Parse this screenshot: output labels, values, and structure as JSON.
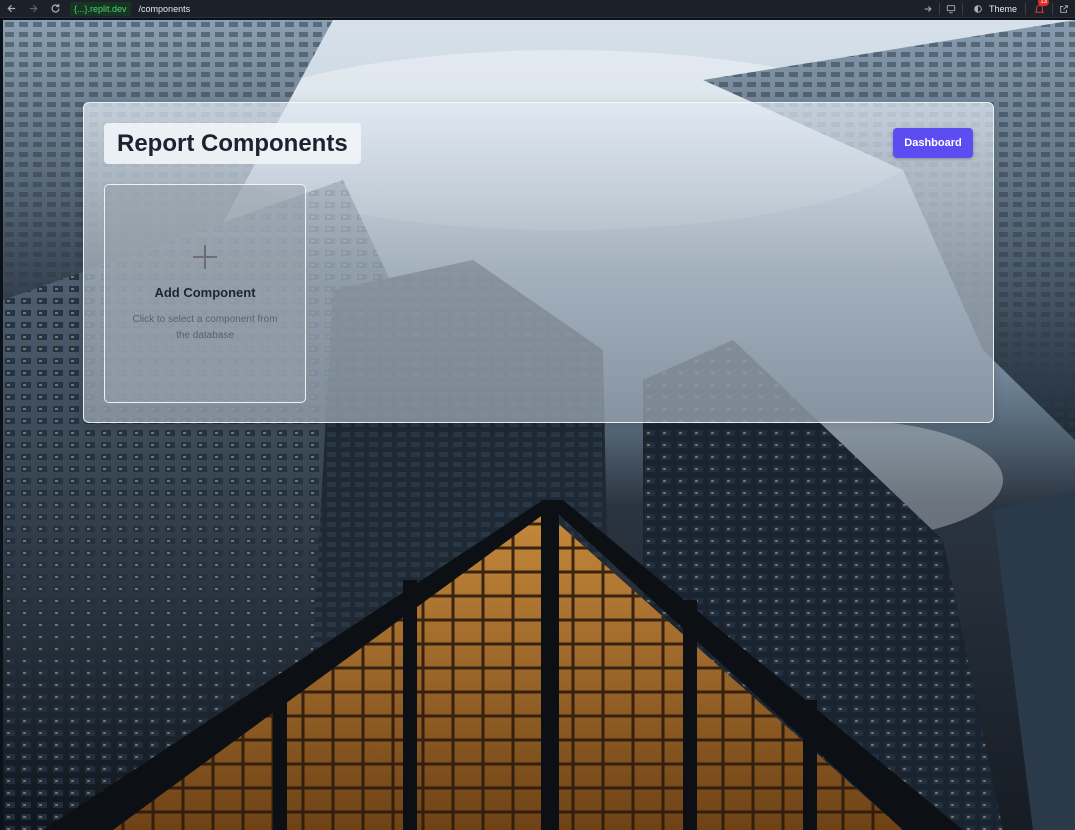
{
  "browser": {
    "url_host": "{...}.replit.dev",
    "url_path": "/components",
    "theme_label": "Theme",
    "notification_count": "13"
  },
  "page": {
    "title": "Report Components",
    "dashboard_label": "Dashboard",
    "add_card": {
      "title": "Add Component",
      "subtitle": "Click to select a component from the database"
    }
  },
  "colors": {
    "accent": "#5b4df1",
    "url_host_text": "#4ad36b"
  },
  "icons": [
    "back-arrow-icon",
    "forward-arrow-icon",
    "reload-icon",
    "go-arrow-icon",
    "monitor-icon",
    "theme-icon",
    "notification-icon",
    "external-link-icon",
    "plus-icon"
  ]
}
